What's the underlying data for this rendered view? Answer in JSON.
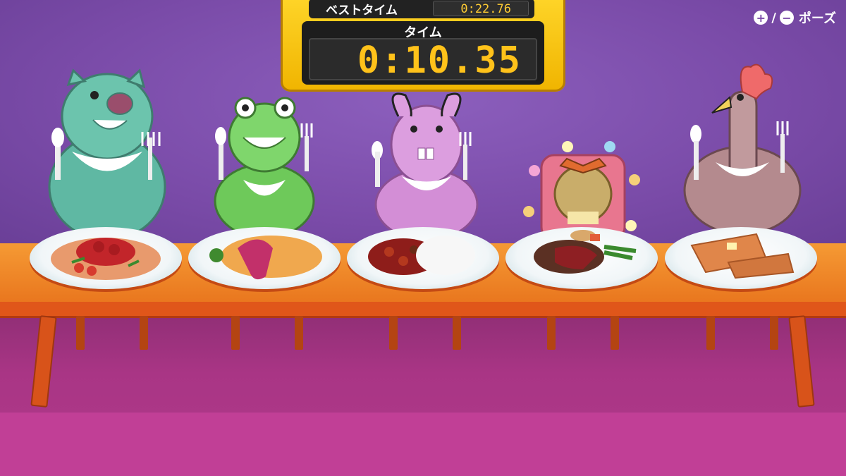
{
  "hud": {
    "best_time_label": "ベストタイム",
    "best_time_value": "0:22.76",
    "time_label": "タイム",
    "time_value": "0:10.35"
  },
  "pause": {
    "plus_icon": "+",
    "minus_icon": "−",
    "separator": "/",
    "label": "ポーズ"
  },
  "characters": [
    {
      "name": "pig",
      "color": "#5fb8a3",
      "dish": "spaghetti"
    },
    {
      "name": "frog",
      "color": "#6ec95a",
      "dish": "omurice"
    },
    {
      "name": "rabbit",
      "color": "#d38ed6",
      "dish": "curry-rice"
    },
    {
      "name": "girl",
      "color": "#c9ad6a",
      "dish": "hamburg-steak"
    },
    {
      "name": "chicken",
      "color": "#b48a8e",
      "dish": "french-toast"
    }
  ],
  "colors": {
    "wall": "#7a4ba8",
    "table": "#f0872a",
    "floor": "#a93585",
    "hud": "#ffd62a",
    "digits": "#ffc21a"
  }
}
